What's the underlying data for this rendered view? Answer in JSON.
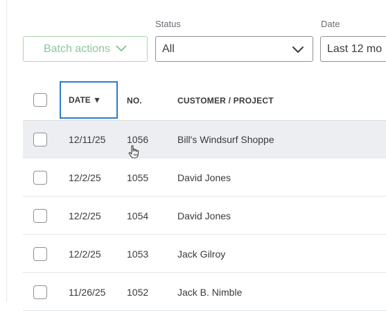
{
  "filters": {
    "status_label": "Status",
    "date_label": "Date",
    "batch_actions_label": "Batch actions",
    "status_value": "All",
    "date_value": "Last 12 mo"
  },
  "table": {
    "headers": {
      "date": "DATE ▼",
      "no": "NO.",
      "customer": "CUSTOMER / PROJECT"
    },
    "rows": [
      {
        "date": "12/11/25",
        "no": "1056",
        "customer": "Bill's Windsurf Shoppe"
      },
      {
        "date": "12/2/25",
        "no": "1055",
        "customer": "David Jones"
      },
      {
        "date": "12/2/25",
        "no": "1054",
        "customer": "David Jones"
      },
      {
        "date": "12/2/25",
        "no": "1053",
        "customer": "Jack Gilroy"
      },
      {
        "date": "11/26/25",
        "no": "1052",
        "customer": "Jack B. Nimble"
      }
    ]
  },
  "colors": {
    "accent_blue": "#2c7bcc",
    "batch_green": "#8ac79a",
    "row_hover": "#eceef1"
  },
  "icons": {
    "batch_chevron": "chevron-down-icon",
    "status_chevron": "chevron-down-icon",
    "pointer": "hand-pointer-icon"
  }
}
